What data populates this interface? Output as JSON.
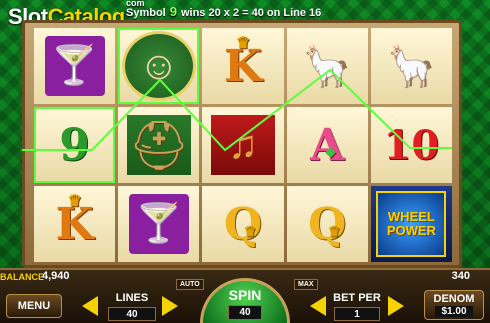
{
  "logo": {
    "slot": "Slot",
    "catalog": "Catalog",
    "com": "com"
  },
  "message": {
    "prefix": "Symbol",
    "symbol": "9",
    "suffix": "wins 20 x 2 = 40 on Line 16"
  },
  "reels": [
    [
      {
        "sym": "margarita",
        "win": false
      },
      {
        "sym": "9",
        "win": true
      },
      {
        "sym": "K",
        "win": false
      }
    ],
    [
      {
        "sym": "lady",
        "win": true
      },
      {
        "sym": "hat",
        "win": false
      },
      {
        "sym": "margarita",
        "win": false
      }
    ],
    [
      {
        "sym": "K",
        "win": false
      },
      {
        "sym": "guitar",
        "win": false
      },
      {
        "sym": "Q",
        "win": false
      }
    ],
    [
      {
        "sym": "pinata",
        "win": false
      },
      {
        "sym": "A",
        "win": false
      },
      {
        "sym": "Q",
        "win": false
      }
    ],
    [
      {
        "sym": "pinata",
        "win": false
      },
      {
        "sym": "10",
        "win": false
      },
      {
        "sym": "wheel",
        "win": false
      }
    ]
  ],
  "wheel": {
    "line1": "WHEEL",
    "line2": "POWER"
  },
  "balance": {
    "label": "BALANCE",
    "value": "4,940"
  },
  "total_bet": "340",
  "controls": {
    "menu": "MENU",
    "lines_label": "LINES",
    "lines_value": "40",
    "auto": "AUTO",
    "spin": "SPIN",
    "spin_value": "40",
    "max": "MAX",
    "bet_per_label": "BET PER",
    "bet_per_value": "1",
    "denom_label": "DENOM",
    "denom_value": "$1.00"
  },
  "colors": {
    "winline": "#5bff3a",
    "accent": "#f5d200",
    "felt": "#0d7a1f"
  }
}
